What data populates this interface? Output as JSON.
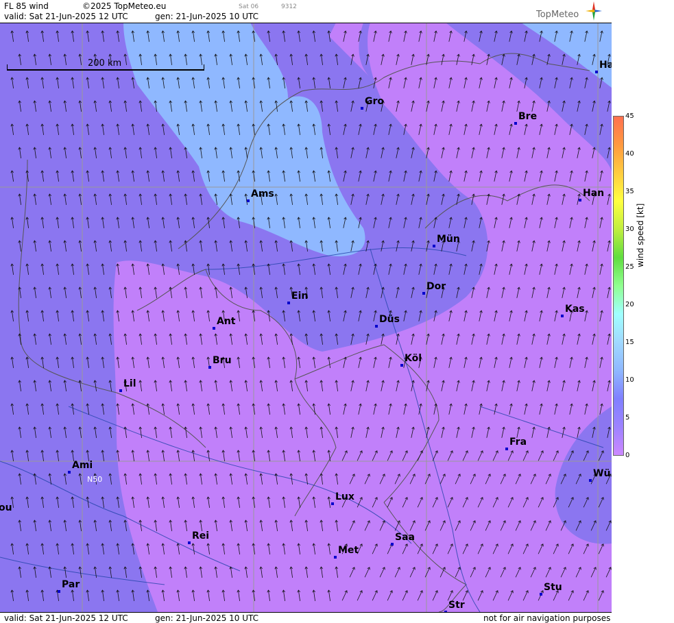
{
  "header": {
    "product": "FL 85 wind",
    "copyright": "©2025 TopMeteo.eu",
    "valid": "valid:  Sat  21-Jun-2025  12 UTC",
    "generated": "gen: 21-Jun-2025 10 UTC",
    "small_left": "Sat 06",
    "small_right": "9312"
  },
  "logo": {
    "text": "TopMeteo"
  },
  "footer": {
    "valid": "valid:  Sat  21-Jun-2025  12 UTC",
    "generated": "gen: 21-Jun-2025 10 UTC",
    "disclaimer": "not for air navigation purposes"
  },
  "scale_bar": {
    "label": "200 km"
  },
  "grid_label": "N50",
  "legend": {
    "title": "wind speed [kt]",
    "ticks": [
      "45",
      "40",
      "35",
      "30",
      "25",
      "20",
      "15",
      "10",
      "5",
      "0"
    ],
    "colors": [
      "#cc88ff",
      "#9d83ff",
      "#8080ff",
      "#8fb8ff",
      "#a0d8ff",
      "#a0ffff",
      "#90ff90",
      "#60dd40",
      "#c0ee40",
      "#ffff40",
      "#ffcc40",
      "#ff9940",
      "#ff7050"
    ]
  },
  "cities": [
    {
      "name": "Gro"
    },
    {
      "name": "Bre"
    },
    {
      "name": "Ha"
    },
    {
      "name": "Ams"
    },
    {
      "name": "Han"
    },
    {
      "name": "Mün"
    },
    {
      "name": "Ein"
    },
    {
      "name": "Dor"
    },
    {
      "name": "Ant"
    },
    {
      "name": "Düs"
    },
    {
      "name": "Kas"
    },
    {
      "name": "Bru"
    },
    {
      "name": "Köl"
    },
    {
      "name": "Lil"
    },
    {
      "name": "Fra"
    },
    {
      "name": "Ami"
    },
    {
      "name": "Wü"
    },
    {
      "name": "Lux"
    },
    {
      "name": "ou"
    },
    {
      "name": "Rei"
    },
    {
      "name": "Saa"
    },
    {
      "name": "Met"
    },
    {
      "name": "Par"
    },
    {
      "name": "Stu"
    },
    {
      "name": "Str"
    }
  ]
}
